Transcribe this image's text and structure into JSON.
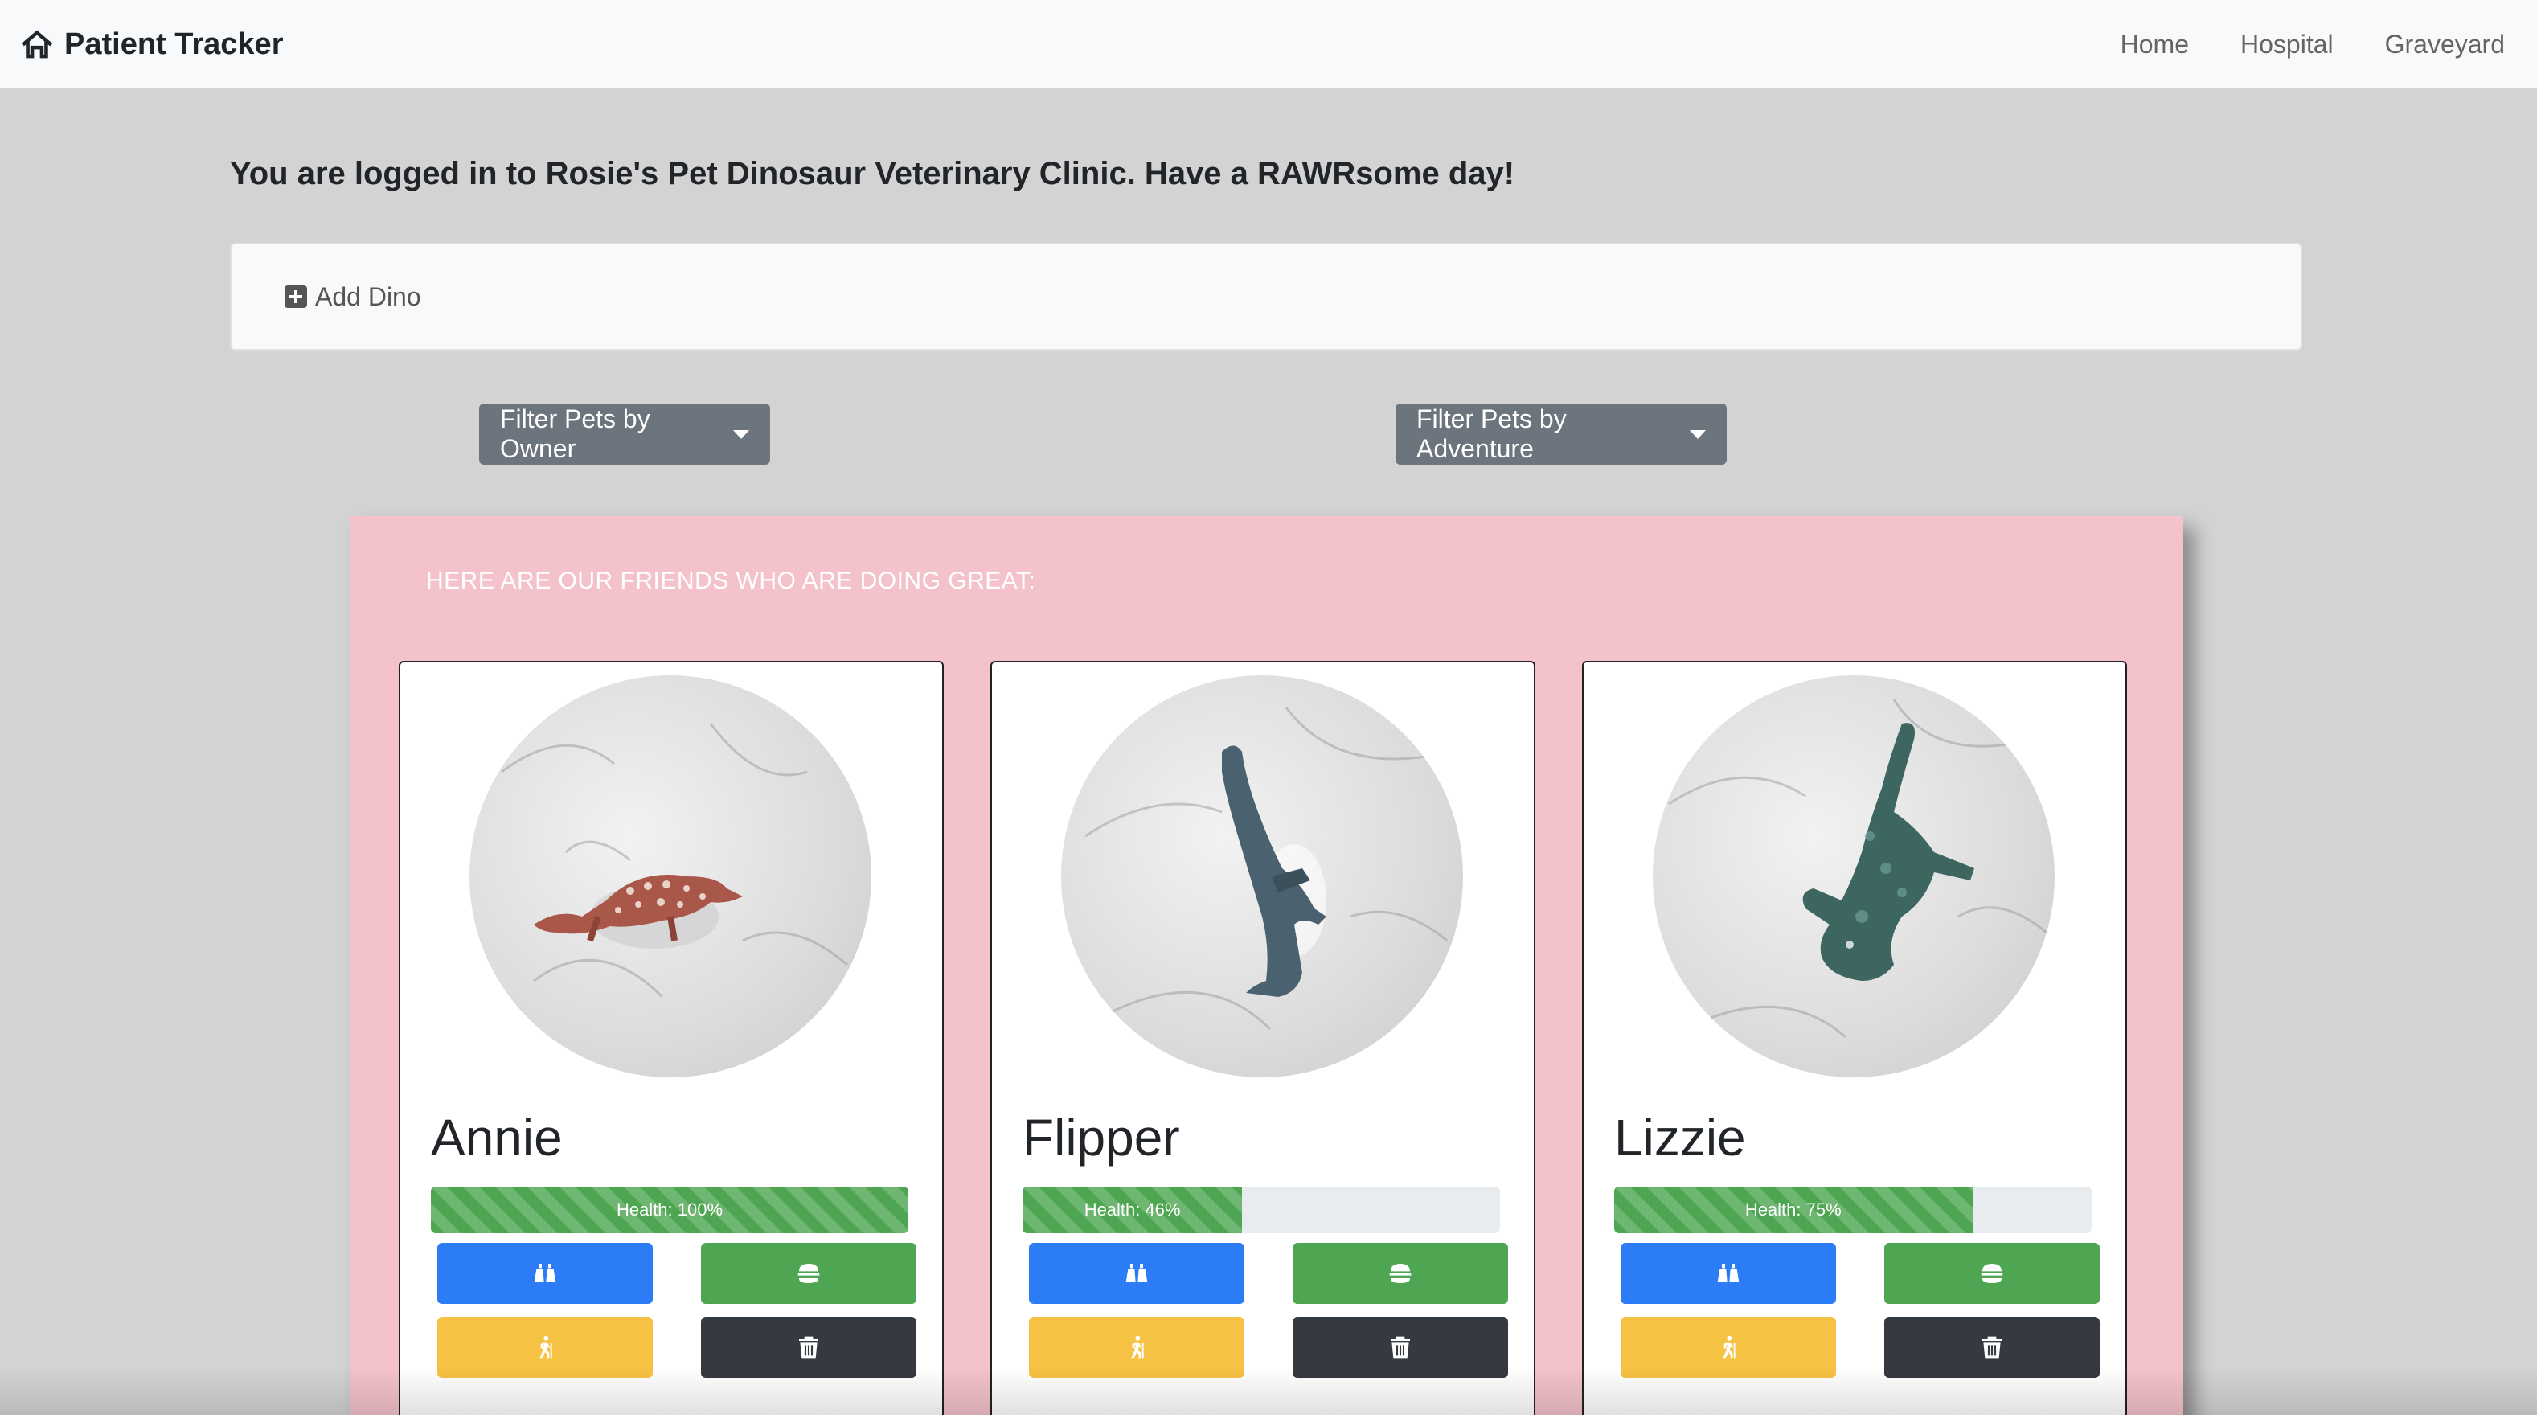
{
  "navbar": {
    "brand_icon": "house-icon",
    "brand": "Patient Tracker",
    "links": [
      "Home",
      "Hospital",
      "Graveyard"
    ]
  },
  "welcome": "You are logged in to Rosie's Pet Dinosaur Veterinary Clinic. Have a RAWRsome day!",
  "add_dino": {
    "icon": "plus-square-icon",
    "label": "Add Dino"
  },
  "filters": {
    "owner": "Filter Pets by Owner",
    "adventure": "Filter Pets by Adventure"
  },
  "panel": {
    "title": "HERE ARE OUR FRIENDS WHO ARE DOING GREAT:",
    "dinos": [
      {
        "name": "Annie",
        "health_label": "Health: 100%",
        "health_percent": 100,
        "image_icon": "red-spotted-dinosaur-figure"
      },
      {
        "name": "Flipper",
        "health_label": "Health: 46%",
        "health_percent": 46,
        "image_icon": "plesiosaur-figure"
      },
      {
        "name": "Lizzie",
        "health_label": "Health: 75%",
        "health_percent": 75,
        "image_icon": "green-dinosaur-figure"
      }
    ],
    "actions": [
      {
        "icon": "binoculars-icon",
        "color": "#2c7cf6"
      },
      {
        "icon": "hamburger-icon",
        "color": "#4ea652"
      },
      {
        "icon": "hiking-icon",
        "color": "#f6c243"
      },
      {
        "icon": "trash-icon",
        "color": "#343a40"
      }
    ]
  },
  "colors": {
    "page_bg": "#d3d3d3",
    "panel_bg": "#f4c2cb",
    "navbar_bg": "#f8f9fa",
    "filter_bg": "#6c757d",
    "health_bar": "#4ea652"
  }
}
